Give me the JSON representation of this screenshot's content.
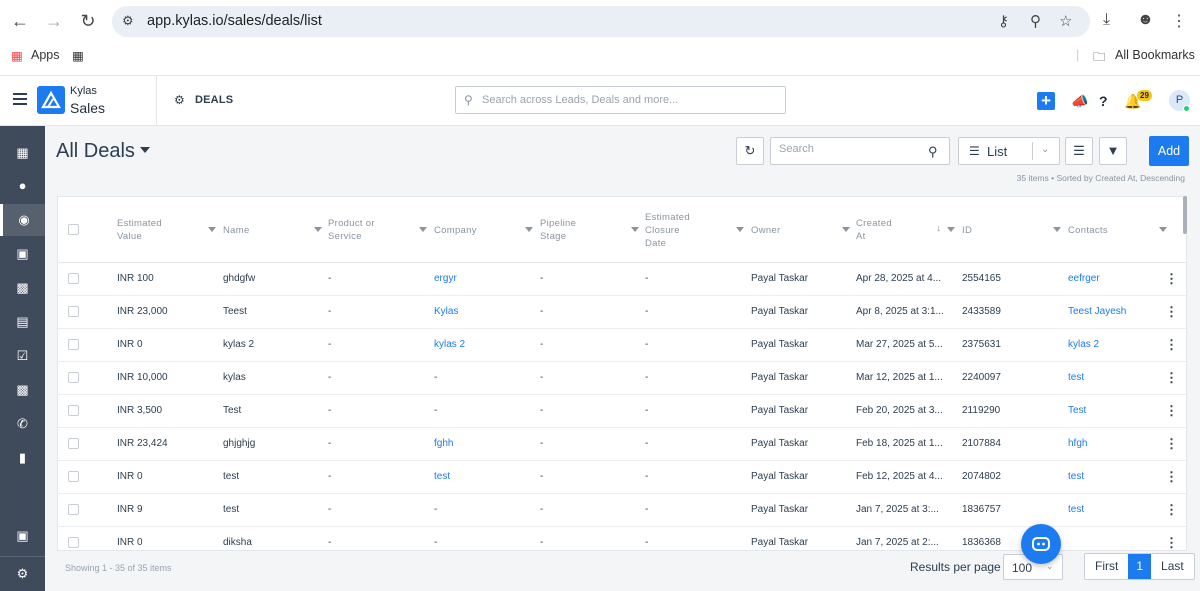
{
  "browser": {
    "url": "app.kylas.io/sales/deals/list",
    "bookmarks": {
      "apps_label": "Apps",
      "all_bookmarks_label": "All Bookmarks"
    }
  },
  "header": {
    "brand_top": "Kylas",
    "brand_bottom": "Sales",
    "module_title": "DEALS",
    "search_placeholder": "Search across Leads, Deals and more...",
    "notification_count": "29",
    "avatar_initial": "P"
  },
  "toolbar": {
    "view_title": "All Deals",
    "search_placeholder": "Search",
    "view_mode": "List",
    "add_label": "Add",
    "meta": "35 items • Sorted by Created At, Descending"
  },
  "table": {
    "columns": [
      {
        "label": "Estimated\nValue"
      },
      {
        "label": "Name"
      },
      {
        "label": "Product or\nService"
      },
      {
        "label": "Company"
      },
      {
        "label": "Pipeline\nStage"
      },
      {
        "label": "Estimated\nClosure\nDate"
      },
      {
        "label": "Owner"
      },
      {
        "label": "Created\nAt"
      },
      {
        "label": "ID"
      },
      {
        "label": "Contacts"
      }
    ],
    "rows": [
      {
        "value": "INR 100",
        "name": "ghdgfw",
        "product": "-",
        "company": "ergyr",
        "stage": "-",
        "closure": "-",
        "owner": "Payal Taskar",
        "created": "Apr 28, 2025 at 4...",
        "id": "2554165",
        "contacts": "eefrger"
      },
      {
        "value": "INR 23,000",
        "name": "Teest",
        "product": "-",
        "company": "Kylas",
        "stage": "-",
        "closure": "-",
        "owner": "Payal Taskar",
        "created": "Apr 8, 2025 at 3:1...",
        "id": "2433589",
        "contacts": "Teest Jayesh"
      },
      {
        "value": "INR 0",
        "name": "kylas 2",
        "product": "-",
        "company": "kylas 2",
        "stage": "-",
        "closure": "-",
        "owner": "Payal Taskar",
        "created": "Mar 27, 2025 at 5...",
        "id": "2375631",
        "contacts": "kylas 2"
      },
      {
        "value": "INR 10,000",
        "name": "kylas",
        "product": "-",
        "company": "-",
        "stage": "-",
        "closure": "-",
        "owner": "Payal Taskar",
        "created": "Mar 12, 2025 at 1...",
        "id": "2240097",
        "contacts": "test"
      },
      {
        "value": "INR 3,500",
        "name": "Test",
        "product": "-",
        "company": "-",
        "stage": "-",
        "closure": "-",
        "owner": "Payal Taskar",
        "created": "Feb 20, 2025 at 3...",
        "id": "2119290",
        "contacts": "Test"
      },
      {
        "value": "INR 23,424",
        "name": "ghjghjg",
        "product": "-",
        "company": "fghh",
        "stage": "-",
        "closure": "-",
        "owner": "Payal Taskar",
        "created": "Feb 18, 2025 at 1...",
        "id": "2107884",
        "contacts": "hfgh"
      },
      {
        "value": "INR 0",
        "name": "test",
        "product": "-",
        "company": "test",
        "stage": "-",
        "closure": "-",
        "owner": "Payal Taskar",
        "created": "Feb 12, 2025 at 4...",
        "id": "2074802",
        "contacts": "test"
      },
      {
        "value": "INR 9",
        "name": "test",
        "product": "-",
        "company": "-",
        "stage": "-",
        "closure": "-",
        "owner": "Payal Taskar",
        "created": "Jan 7, 2025 at 3:...",
        "id": "1836757",
        "contacts": "test"
      },
      {
        "value": "INR 0",
        "name": "diksha",
        "product": "-",
        "company": "-",
        "stage": "-",
        "closure": "-",
        "owner": "Payal Taskar",
        "created": "Jan 7, 2025 at 2:...",
        "id": "1836368",
        "contacts": ""
      }
    ]
  },
  "footer": {
    "showing": "Showing 1 - 35 of 35 items",
    "results_per_page_label": "Results per page",
    "results_per_page": "100",
    "pager": {
      "first": "First",
      "current": "1",
      "last": "Last"
    }
  },
  "colors": {
    "accent": "#1d7bf0",
    "sidebar": "#3f4a5a",
    "notification_badge": "#f5c518"
  }
}
